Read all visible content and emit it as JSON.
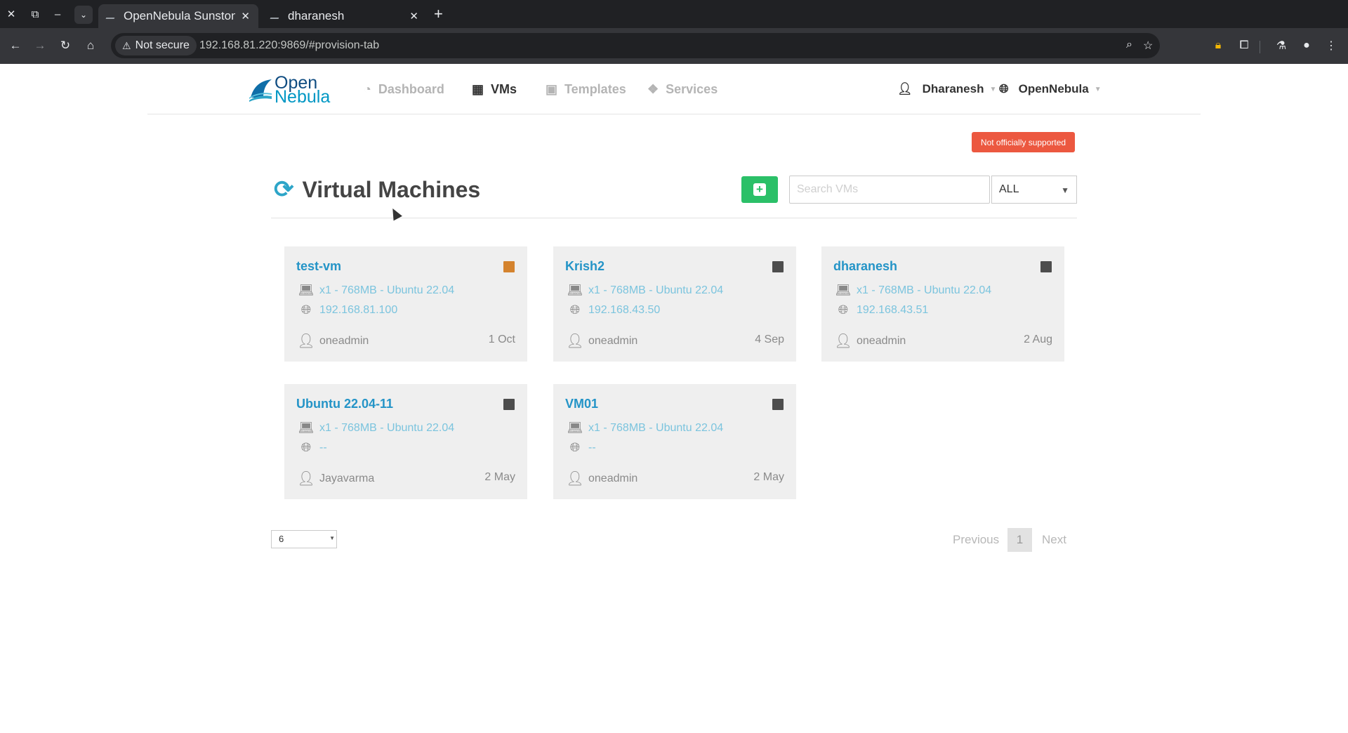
{
  "browser": {
    "tabs": [
      {
        "title": "OpenNebula Sunstone",
        "active": true
      },
      {
        "title": "dharanesh",
        "active": false
      }
    ],
    "security_label": "Not secure",
    "url": "192.168.81.220:9869/#provision-tab"
  },
  "header": {
    "logo_line1": "Open",
    "logo_line2": "Nebula",
    "nav": [
      {
        "label": "Dashboard",
        "icon": "dashboard-icon",
        "active": false
      },
      {
        "label": "VMs",
        "icon": "grid-icon",
        "active": true
      },
      {
        "label": "Templates",
        "icon": "save-icon",
        "active": false
      },
      {
        "label": "Services",
        "icon": "cubes-icon",
        "active": false
      }
    ],
    "user": "Dharanesh",
    "zone": "OpenNebula"
  },
  "notice": "Not officially supported",
  "page": {
    "title": "Virtual Machines",
    "search_placeholder": "Search VMs",
    "filter_value": "ALL"
  },
  "vms": [
    {
      "name": "test-vm",
      "spec": "x1 - 768MB - Ubuntu 22.04",
      "ip": "192.168.81.100",
      "owner": "oneadmin",
      "date": "1 Oct",
      "state_color": "#d4832e"
    },
    {
      "name": "Krish2",
      "spec": "x1 - 768MB - Ubuntu 22.04",
      "ip": "192.168.43.50",
      "owner": "oneadmin",
      "date": "4 Sep",
      "state_color": "#4d4d4d"
    },
    {
      "name": "dharanesh",
      "spec": "x1 - 768MB - Ubuntu 22.04",
      "ip": "192.168.43.51",
      "owner": "oneadmin",
      "date": "2 Aug",
      "state_color": "#4d4d4d"
    },
    {
      "name": "Ubuntu 22.04-11",
      "spec": "x1 - 768MB - Ubuntu 22.04",
      "ip": "--",
      "owner": "Jayavarma",
      "date": "2 May",
      "state_color": "#4d4d4d"
    },
    {
      "name": "VM01",
      "spec": "x1 - 768MB - Ubuntu 22.04",
      "ip": "--",
      "owner": "oneadmin",
      "date": "2 May",
      "state_color": "#4d4d4d"
    }
  ],
  "pagination": {
    "page_size": "6",
    "previous": "Previous",
    "current": "1",
    "next": "Next"
  }
}
